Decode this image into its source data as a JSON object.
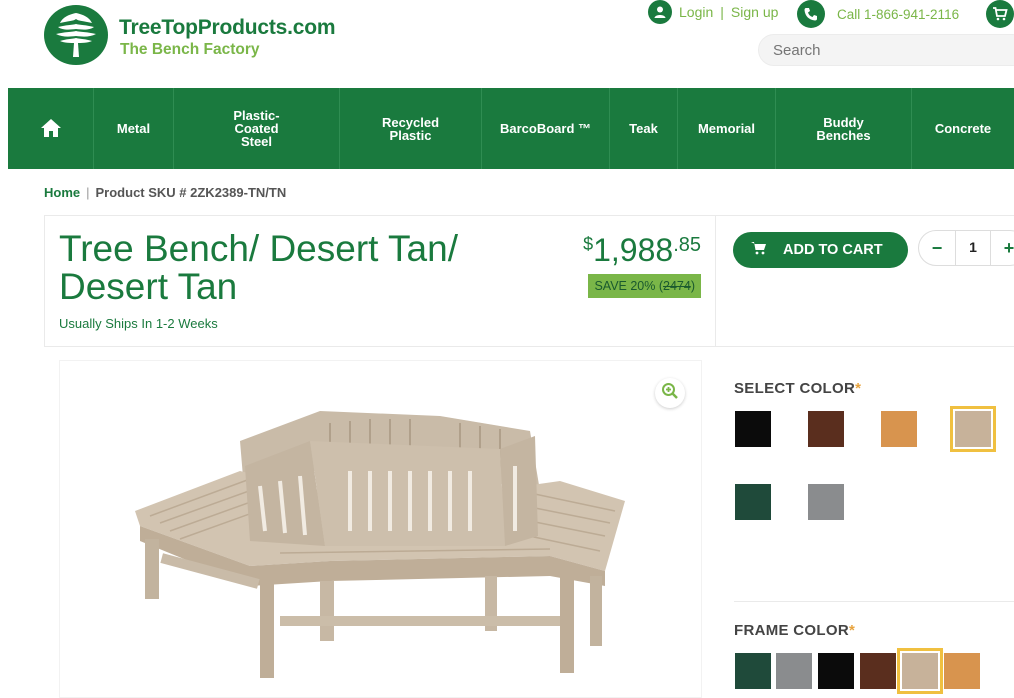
{
  "header": {
    "brand_name": "TreeTopProducts.com",
    "brand_tagline": "The Bench Factory",
    "login": "Login",
    "signup": "Sign up",
    "separator": "|",
    "phone": "Call 1-866-941-2116",
    "search_placeholder": "Search"
  },
  "nav": {
    "items": [
      {
        "label": "Metal"
      },
      {
        "label": "Plastic-Coated Steel"
      },
      {
        "label": "Recycled Plastic"
      },
      {
        "label": "BarcoBoard ™"
      },
      {
        "label": "Teak"
      },
      {
        "label": "Memorial"
      },
      {
        "label": "Buddy Benches"
      },
      {
        "label": "Concrete"
      }
    ]
  },
  "breadcrumb": {
    "home": "Home",
    "separator": "|",
    "current": "Product SKU # 2ZK2389-TN/TN"
  },
  "product": {
    "title": "Tree Bench/ Desert Tan/ Desert Tan",
    "shipping": "Usually Ships In 1-2 Weeks",
    "price_currency": "$",
    "price_whole": "1,988",
    "price_cents": ".85",
    "save_label": "SAVE 20% (",
    "save_old_price": "2474",
    "save_close": ")",
    "add_to_cart": "ADD TO CART",
    "quantity": "1",
    "qty_minus": "−",
    "qty_plus": "+"
  },
  "options": {
    "select_color_label": "SELECT COLOR",
    "frame_color_label": "FRAME COLOR",
    "required_mark": "*",
    "colors": [
      {
        "name": "black",
        "hex": "#0b0b0b",
        "selected": false
      },
      {
        "name": "brown",
        "hex": "#5a2e1e",
        "selected": false
      },
      {
        "name": "cedar",
        "hex": "#d8944e",
        "selected": false
      },
      {
        "name": "desert-tan",
        "hex": "#c7b29a",
        "selected": true
      },
      {
        "name": "green",
        "hex": "#1f4a3a",
        "selected": false
      },
      {
        "name": "gray",
        "hex": "#8a8c8e",
        "selected": false
      }
    ],
    "frame_colors": [
      {
        "name": "green",
        "hex": "#1f4a3a",
        "selected": false
      },
      {
        "name": "gray",
        "hex": "#8a8c8e",
        "selected": false
      },
      {
        "name": "black",
        "hex": "#0b0b0b",
        "selected": false
      },
      {
        "name": "brown",
        "hex": "#5a2e1e",
        "selected": false
      },
      {
        "name": "desert-tan",
        "hex": "#c7b29a",
        "selected": true
      },
      {
        "name": "cedar",
        "hex": "#d8944e",
        "selected": false
      }
    ]
  },
  "colors": {
    "brand_green": "#1a7a3e",
    "accent_green": "#7ab648",
    "required_star": "#e8a33d",
    "selected_outline": "#f0c040"
  }
}
